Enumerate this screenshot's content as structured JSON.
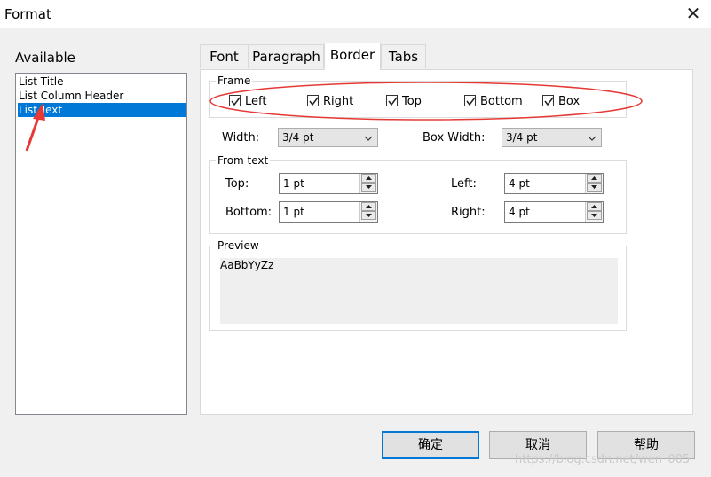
{
  "window": {
    "title": "Format"
  },
  "available": {
    "label": "Available",
    "items": [
      "List Title",
      "List Column Header",
      "List Text"
    ],
    "selected_index": 2
  },
  "tabs": [
    {
      "label": "Font"
    },
    {
      "label": "Paragraph"
    },
    {
      "label": "Border",
      "active": true
    },
    {
      "label": "Tabs"
    }
  ],
  "frame": {
    "label": "Frame",
    "checkboxes": [
      {
        "label": "Left",
        "checked": true
      },
      {
        "label": "Right",
        "checked": true
      },
      {
        "label": "Top",
        "checked": true
      },
      {
        "label": "Bottom",
        "checked": true
      },
      {
        "label": "Box",
        "checked": true
      }
    ]
  },
  "width": {
    "label": "Width:",
    "value": "3/4 pt"
  },
  "box_width": {
    "label": "Box Width:",
    "value": "3/4 pt"
  },
  "from_text": {
    "label": "From text",
    "top": {
      "label": "Top:",
      "value": "1 pt"
    },
    "bottom": {
      "label": "Bottom:",
      "value": "1 pt"
    },
    "left": {
      "label": "Left:",
      "value": "4 pt"
    },
    "right": {
      "label": "Right:",
      "value": "4 pt"
    }
  },
  "preview": {
    "label": "Preview",
    "sample": "AaBbYyZz"
  },
  "buttons": {
    "ok": "确定",
    "cancel": "取消",
    "help": "帮助"
  },
  "watermark": "https://blog.csdn.net/wen_005",
  "annotation_color": "#e53935",
  "selection_color": "#0078d7"
}
